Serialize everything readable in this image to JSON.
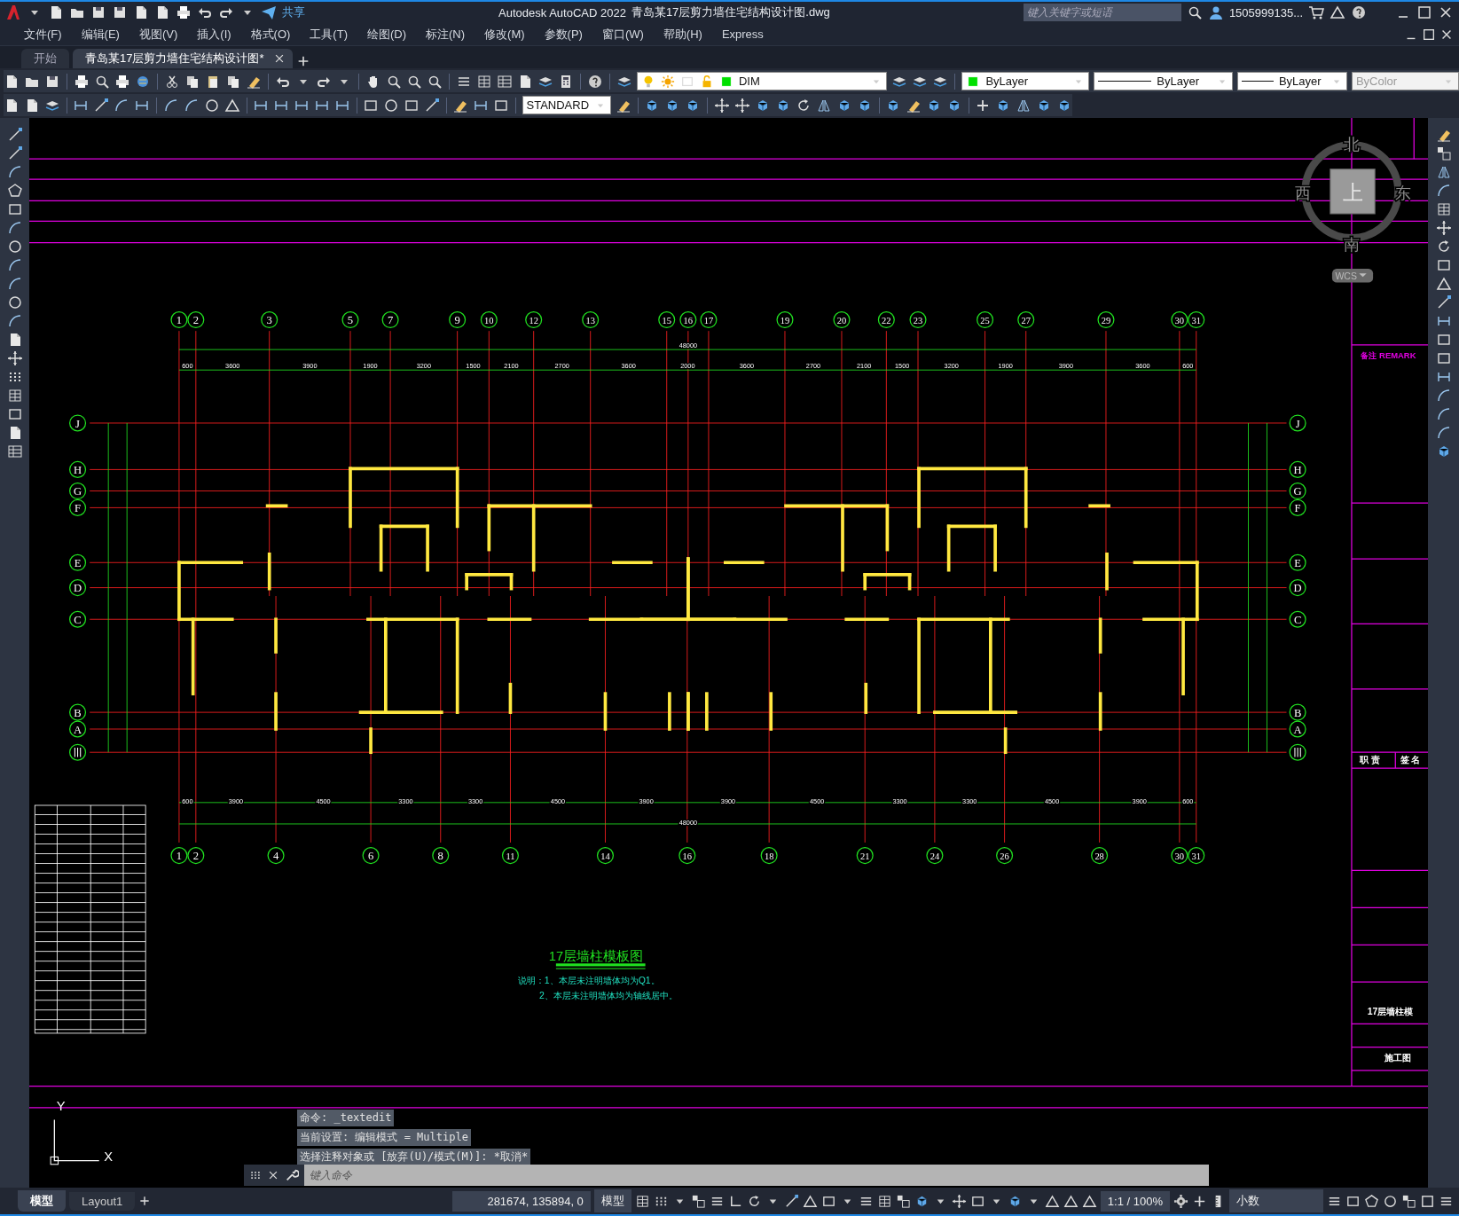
{
  "title_bar": {
    "share": "共享",
    "app_title": "Autodesk AutoCAD 2022",
    "file_title": "青岛某17层剪力墙住宅结构设计图.dwg",
    "search": {
      "placeholder": "键入关键字或短语"
    },
    "user": "1505999135..."
  },
  "menu": [
    "文件(F)",
    "编辑(E)",
    "视图(V)",
    "插入(I)",
    "格式(O)",
    "工具(T)",
    "绘图(D)",
    "标注(N)",
    "修改(M)",
    "参数(P)",
    "窗口(W)",
    "帮助(H)",
    "Express"
  ],
  "doc_tabs": [
    {
      "label": "开始",
      "selected": false
    },
    {
      "label": "青岛某17层剪力墙住宅结构设计图*",
      "selected": true
    }
  ],
  "toolbar": {
    "layer": "DIM",
    "text_style": "STANDARD",
    "color_value": "ByLayer",
    "linetype": "ByLayer",
    "lineweight": "ByLayer",
    "plot_style": "ByColor"
  },
  "drawing": {
    "top_axes": [
      "1",
      "2",
      "3",
      "5",
      "7",
      "9",
      "10",
      "12",
      "13",
      "15",
      "16",
      "17",
      "19",
      "20",
      "22",
      "23",
      "25",
      "27",
      "29",
      "30",
      "31"
    ],
    "bottom_axes": [
      "1",
      "2",
      "4",
      "6",
      "8",
      "11",
      "14",
      "16",
      "18",
      "21",
      "24",
      "26",
      "28",
      "30",
      "31"
    ],
    "row_axes_left": [
      "J",
      "H",
      "G",
      "F",
      "E",
      "D",
      "C",
      "B",
      "A"
    ],
    "row_axes_right": [
      "J",
      "H",
      "G",
      "F",
      "E",
      "D",
      "C",
      "B",
      "A"
    ],
    "top_total": "48000",
    "top_dims": [
      "600",
      "3600",
      "3900",
      "1900",
      "3200",
      "1500",
      "2100",
      "2700",
      "3600",
      "2000",
      "3600",
      "2700",
      "2100",
      "1500",
      "3200",
      "1900",
      "3900",
      "3600",
      "600"
    ],
    "bottom_dims": [
      "600",
      "3900",
      "4500",
      "3300",
      "3300",
      "4500",
      "3900",
      "3900",
      "4500",
      "3300",
      "3300",
      "4500",
      "3900",
      "600"
    ],
    "bottom_total": "48000",
    "plan_title": "17层墙柱模板图",
    "notes": [
      "说明：1、本层未注明墙体均为Q1。",
      "2、本层未注明墙体均为轴线居中。"
    ],
    "title_block": [
      "备注 REMARK",
      "职 责",
      "签 名",
      "17层墙柱模",
      "施工图"
    ]
  },
  "viewcube": {
    "north": "北",
    "south": "南",
    "east": "东",
    "west": "西",
    "top": "上",
    "wcs": "WCS"
  },
  "ucs": {
    "x": "X",
    "y": "Y"
  },
  "command_history": [
    "命令: _textedit",
    "当前设置: 编辑模式 = Multiple",
    "选择注释对象或 [放弃(U)/模式(M)]: *取消*"
  ],
  "command_input": {
    "placeholder": "键入命令"
  },
  "layout_tabs": [
    {
      "label": "模型",
      "selected": true
    },
    {
      "label": "Layout1",
      "selected": false
    }
  ],
  "status_bar": {
    "coordinates": "281674, 135894, 0",
    "space": "模型",
    "scale": "1:1 / 100%",
    "units": "小数"
  }
}
